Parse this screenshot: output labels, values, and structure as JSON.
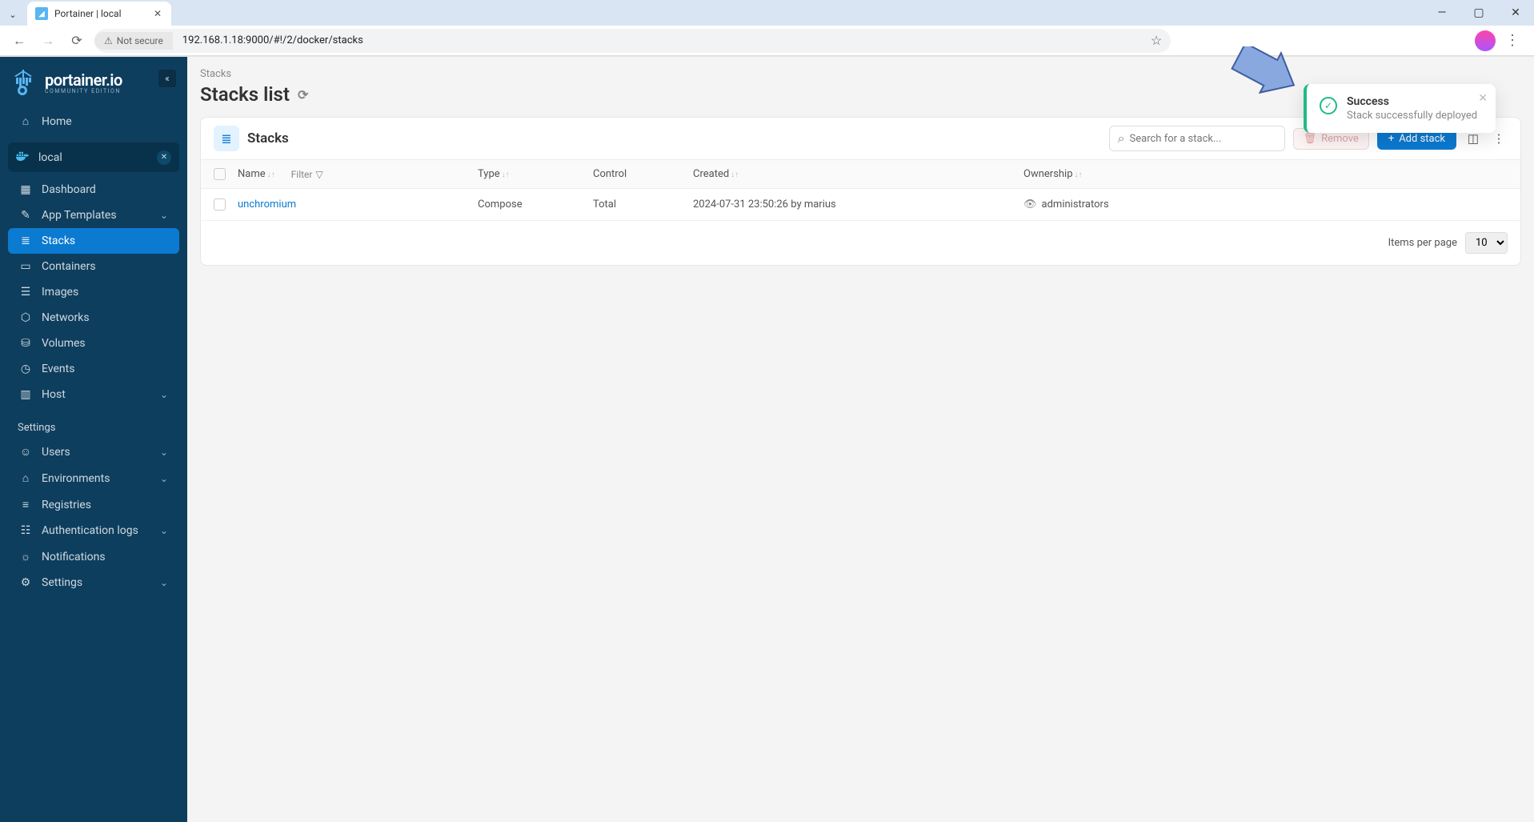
{
  "browser": {
    "tab_title": "Portainer | local",
    "not_secure": "Not secure",
    "url": "192.168.1.18:9000/#!/2/docker/stacks"
  },
  "sidebar": {
    "brand": "portainer.io",
    "brand_sub": "COMMUNITY EDITION",
    "home": "Home",
    "env_label": "local",
    "nav": {
      "dashboard": "Dashboard",
      "app_templates": "App Templates",
      "stacks": "Stacks",
      "containers": "Containers",
      "images": "Images",
      "networks": "Networks",
      "volumes": "Volumes",
      "events": "Events",
      "host": "Host"
    },
    "settings_heading": "Settings",
    "settings": {
      "users": "Users",
      "environments": "Environments",
      "registries": "Registries",
      "auth_logs": "Authentication logs",
      "notifications": "Notifications",
      "settings": "Settings"
    }
  },
  "main": {
    "breadcrumb": "Stacks",
    "title": "Stacks list",
    "panel_title": "Stacks",
    "search_placeholder": "Search for a stack...",
    "remove_label": "Remove",
    "add_label": "Add stack",
    "columns": {
      "name": "Name",
      "filter": "Filter",
      "type": "Type",
      "control": "Control",
      "created": "Created",
      "ownership": "Ownership"
    },
    "rows": [
      {
        "name": "unchromium",
        "type": "Compose",
        "control": "Total",
        "created": "2024-07-31 23:50:26 by marius",
        "ownership": "administrators"
      }
    ],
    "items_per_page_label": "Items per page",
    "items_per_page_value": "10"
  },
  "toast": {
    "title": "Success",
    "message": "Stack successfully deployed"
  }
}
